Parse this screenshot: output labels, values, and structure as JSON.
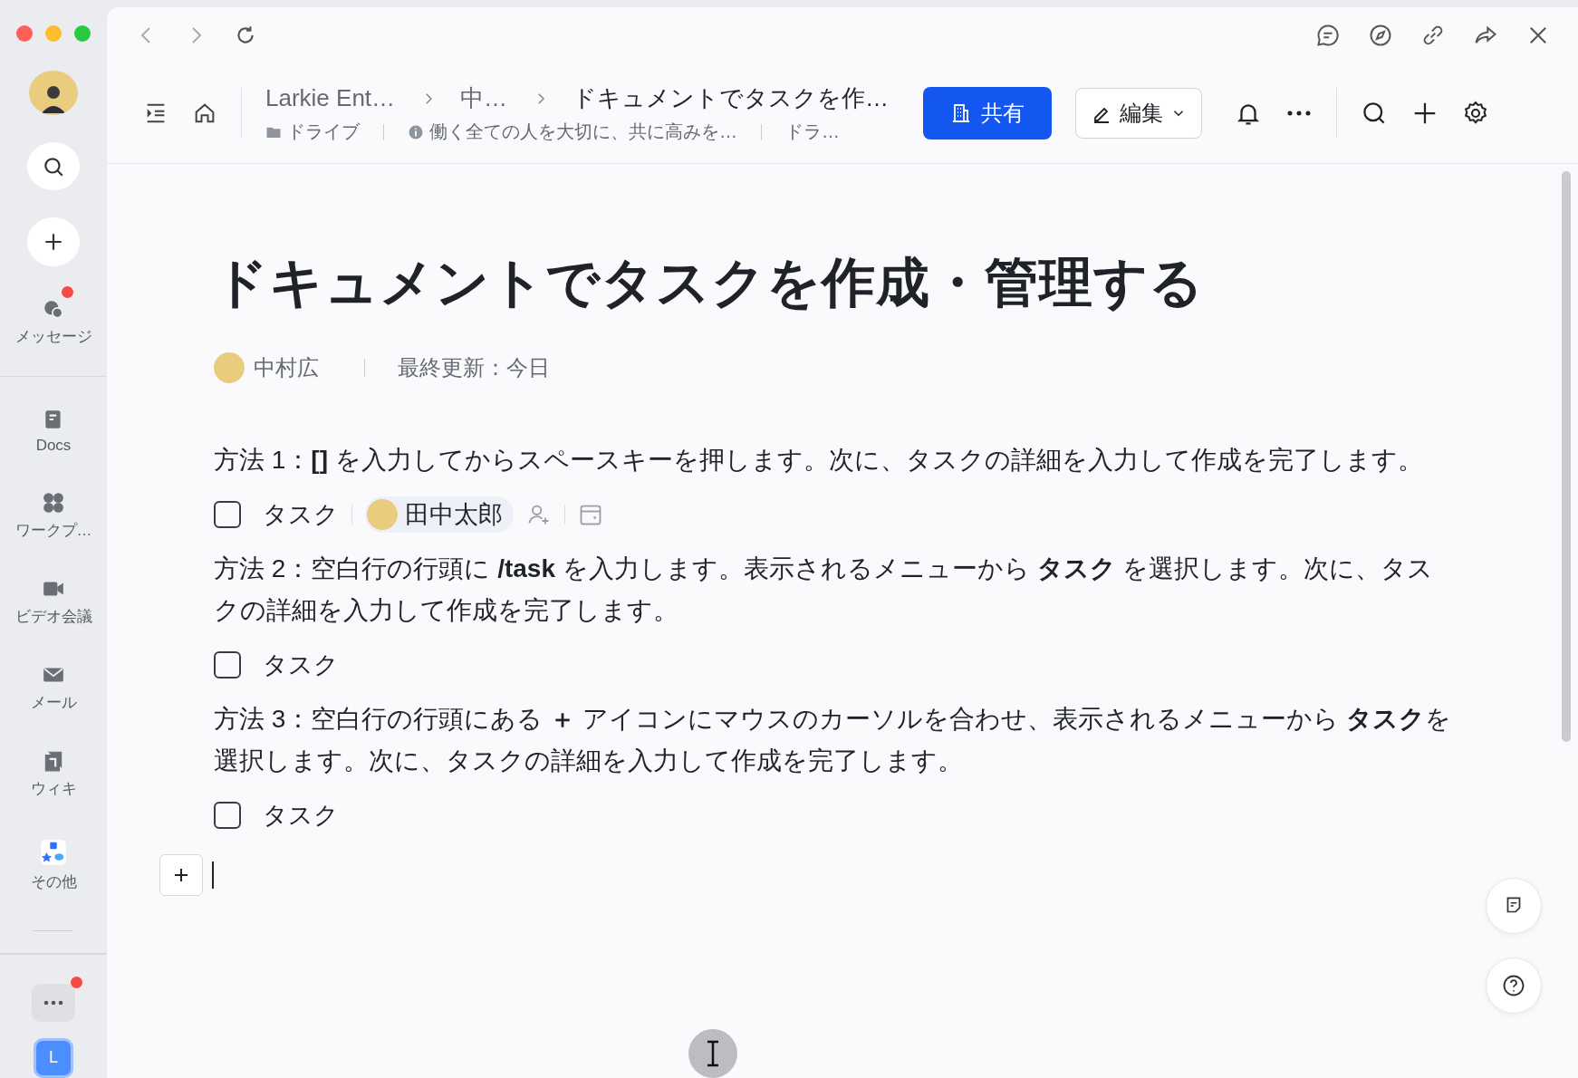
{
  "sidebar": {
    "items": [
      {
        "kind": "messages",
        "label": "メッセージ",
        "badge": true,
        "selected": false
      },
      {
        "kind": "docs",
        "label": "Docs",
        "badge": false,
        "selected": false
      },
      {
        "kind": "workplace",
        "label": "ワークプ…",
        "badge": false,
        "selected": false
      },
      {
        "kind": "video",
        "label": "ビデオ会議",
        "badge": false,
        "selected": false
      },
      {
        "kind": "mail",
        "label": "メール",
        "badge": false,
        "selected": false
      },
      {
        "kind": "wiki",
        "label": "ウィキ",
        "badge": false,
        "selected": false
      },
      {
        "kind": "more",
        "label": "その他",
        "badge": false,
        "selected": false
      }
    ],
    "more_badge": true,
    "app_letter": "L"
  },
  "header": {
    "breadcrumbs": [
      "Larkie Ent…",
      "中…",
      "ドキュメントでタスクを作…"
    ],
    "location": [
      "ドライブ",
      "働く全ての人を大切に、共に高みを…",
      "ドラ…"
    ],
    "share_button": "共有",
    "edit_button": "編集"
  },
  "document": {
    "title": "ドキュメントでタスクを作成・管理する",
    "author": "中村広",
    "updated": "最終更新：今日",
    "blocks": [
      {
        "kind": "paragraph",
        "text": "方法 1：**[]** を入力してからスペースキーを押します。次に、タスクの詳細を入力して作成を完了します。"
      },
      {
        "kind": "task",
        "label": "タスク",
        "checked": false,
        "assignee": "田中太郎"
      },
      {
        "kind": "paragraph",
        "text": "方法 2：空白行の行頭に **/task** を入力します。表示されるメニューから **タスク** を選択します。次に、タスクの詳細を入力して作成を完了します。"
      },
      {
        "kind": "task",
        "label": "タスク",
        "checked": false
      },
      {
        "kind": "paragraph",
        "text": "方法 3：空白行の行頭にある **＋** アイコンにマウスのカーソルを合わせ、表示されるメニューから **タスク**を選択します。次に、タスクの詳細を入力して作成を完了します。"
      },
      {
        "kind": "task",
        "label": "タスク",
        "checked": false
      }
    ]
  }
}
